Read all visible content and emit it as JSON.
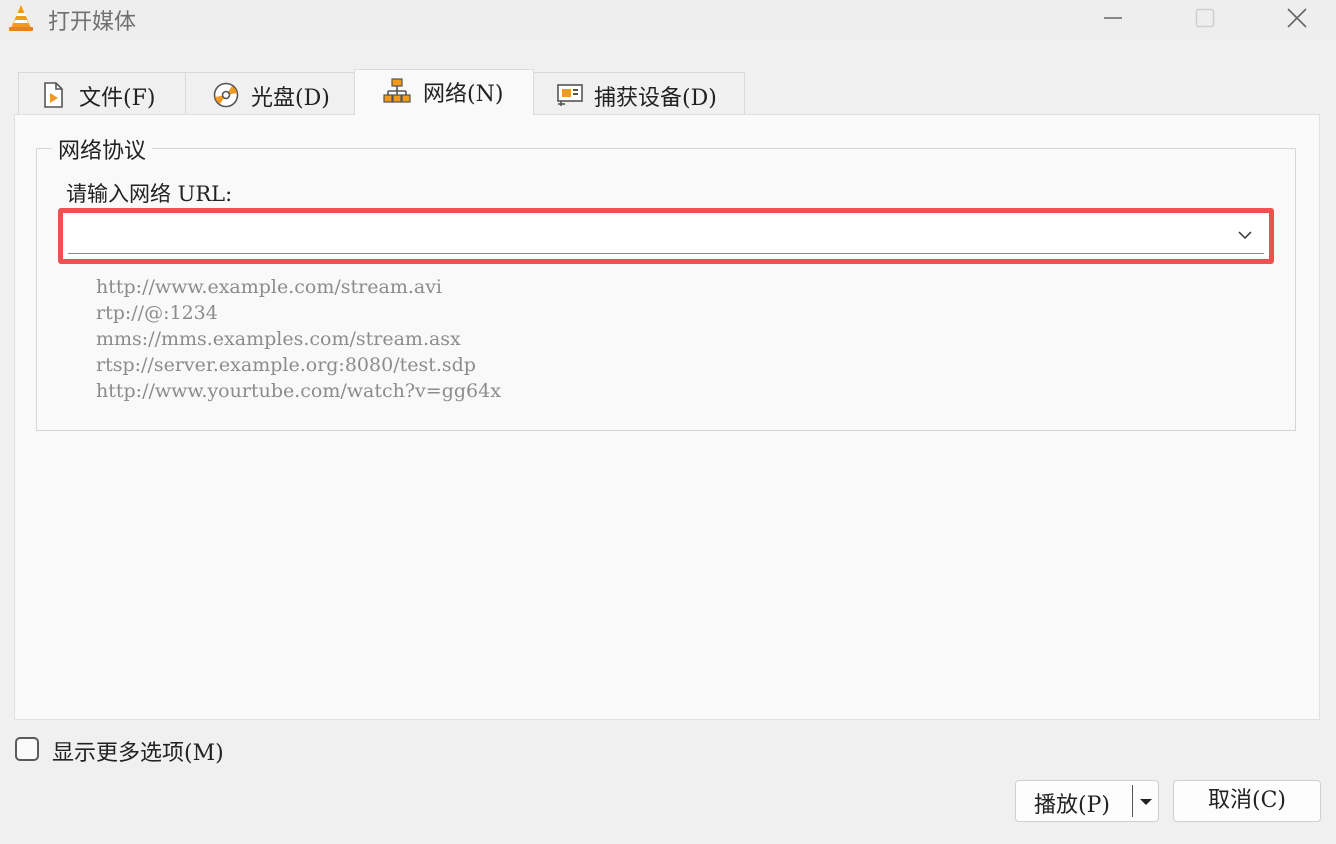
{
  "window": {
    "title": "打开媒体",
    "app_icon": "vlc-cone-icon",
    "controls": [
      "minimize-icon",
      "maximize-icon",
      "close-icon"
    ]
  },
  "tabs": [
    {
      "label": "文件(F)",
      "icon": "file-play-icon",
      "active": false
    },
    {
      "label": "光盘(D)",
      "icon": "disc-icon",
      "active": false
    },
    {
      "label": "网络(N)",
      "icon": "network-icon",
      "active": true
    },
    {
      "label": "捕获设备(D)",
      "icon": "capture-card-icon",
      "active": false
    }
  ],
  "network": {
    "group_title": "网络协议",
    "url_label": "请输入网络 URL:",
    "url_value": "",
    "examples": [
      "http://www.example.com/stream.avi",
      "rtp://@:1234",
      "mms://mms.examples.com/stream.asx",
      "rtsp://server.example.org:8080/test.sdp",
      "http://www.yourtube.com/watch?v=gg64x"
    ]
  },
  "options": {
    "show_more_label": "显示更多选项(M)",
    "show_more_checked": false
  },
  "buttons": {
    "play_label": "播放(P)",
    "cancel_label": "取消(C)"
  },
  "colors": {
    "accent_orange": "#f39a1e",
    "highlight_red": "#f05050"
  }
}
